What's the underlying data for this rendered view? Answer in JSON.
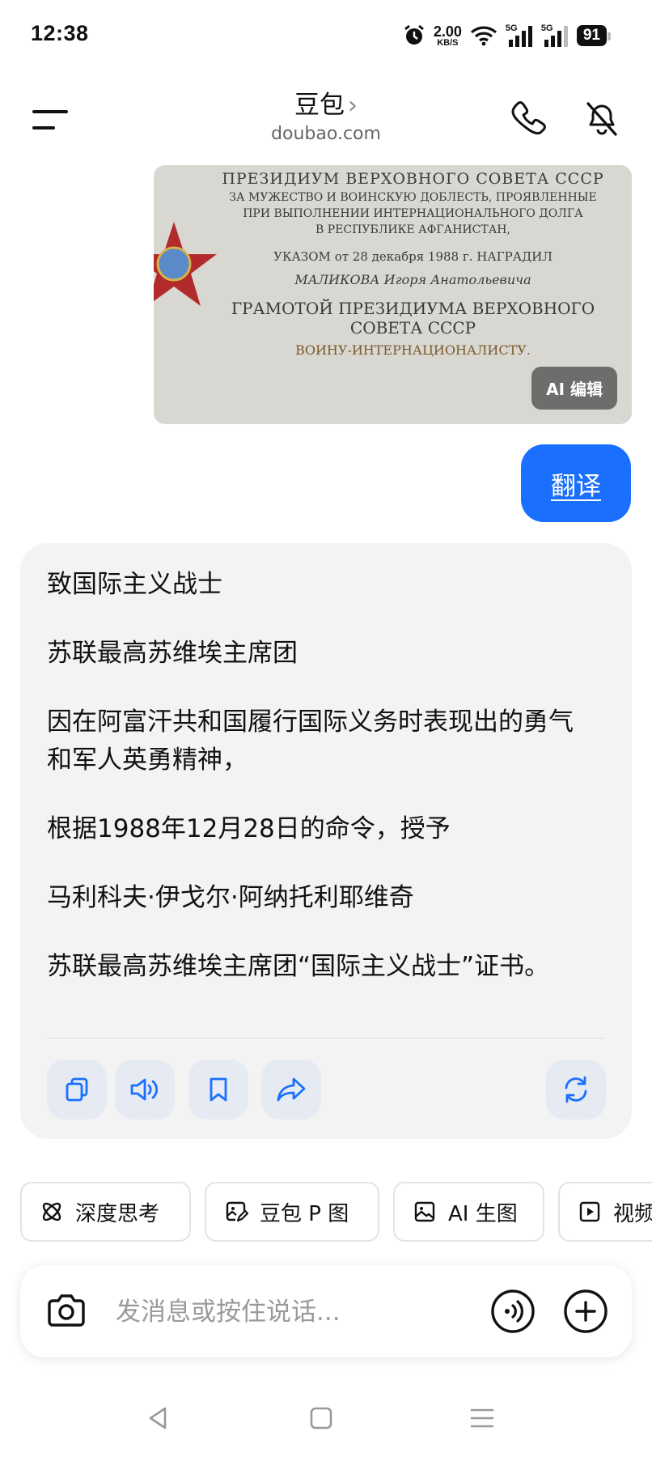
{
  "status": {
    "time": "12:38",
    "net_speed_value": "2.00",
    "net_speed_unit": "KB/S",
    "signal_1_label": "5G",
    "signal_2_label": "5G",
    "battery": "91",
    "icons": [
      "alarm-icon",
      "wifi-icon",
      "signal-icon",
      "signal-icon",
      "battery-icon"
    ]
  },
  "header": {
    "title": "豆包",
    "chevron": "›",
    "domain": "doubao.com",
    "icons": [
      "menu-icon",
      "phone-icon",
      "mute-icon"
    ]
  },
  "image_message": {
    "document_text": [
      "ПРЕЗИДИУМ ВЕРХОВНОГО СОВЕТА СССР",
      "ЗА МУЖЕСТВО И ВОИНСКУЮ ДОБЛЕСТЬ, ПРОЯВЛЕННЫЕ",
      "ПРИ ВЫПОЛНЕНИИ ИНТЕРНАЦИОНАЛЬНОГО ДОЛГА",
      "В РЕСПУБЛИКЕ АФГАНИСТАН,",
      "УКАЗОМ от 28 декабря 1988 г. НАГРАДИЛ",
      "МАЛИКОВА Игоря Анатольевича",
      "ГРАМОТОЙ ПРЕЗИДИУМА ВЕРХОВНОГО СОВЕТА СССР",
      "ВОИНУ-ИНТЕРНАЦИОНАЛИСТУ."
    ],
    "ai_edit_label": "AI 编辑"
  },
  "user_message": {
    "text": "翻译"
  },
  "answer": {
    "paragraphs": [
      "致国际主义战士",
      "苏联最高苏维埃主席团",
      "因在阿富汗共和国履行国际义务时表现出的勇气和军人英勇精神，",
      "根据1988年12月28日的命令，授予",
      "马利科夫·伊戈尔·阿纳托利耶维奇",
      "苏联最高苏维埃主席团“国际主义战士”证书。"
    ],
    "actions": [
      "copy-icon",
      "speaker-icon",
      "bookmark-icon",
      "share-icon",
      "regenerate-icon"
    ]
  },
  "chips": [
    {
      "label": "深度思考",
      "icon": "atom-icon"
    },
    {
      "label": "豆包 P 图",
      "icon": "image-edit-icon"
    },
    {
      "label": "AI 生图",
      "icon": "image-icon"
    },
    {
      "label": "视频",
      "icon": "video-icon"
    }
  ],
  "input": {
    "placeholder": "发消息或按住说话...",
    "value": "",
    "icons": [
      "camera-icon",
      "voice-call-icon",
      "plus-icon"
    ]
  },
  "nav": {
    "icons": [
      "back-icon",
      "home-icon",
      "recents-icon"
    ]
  },
  "colors": {
    "accent": "#1a6fff",
    "card_bg": "#f3f3f3",
    "action_bg": "#e6ebf3"
  }
}
